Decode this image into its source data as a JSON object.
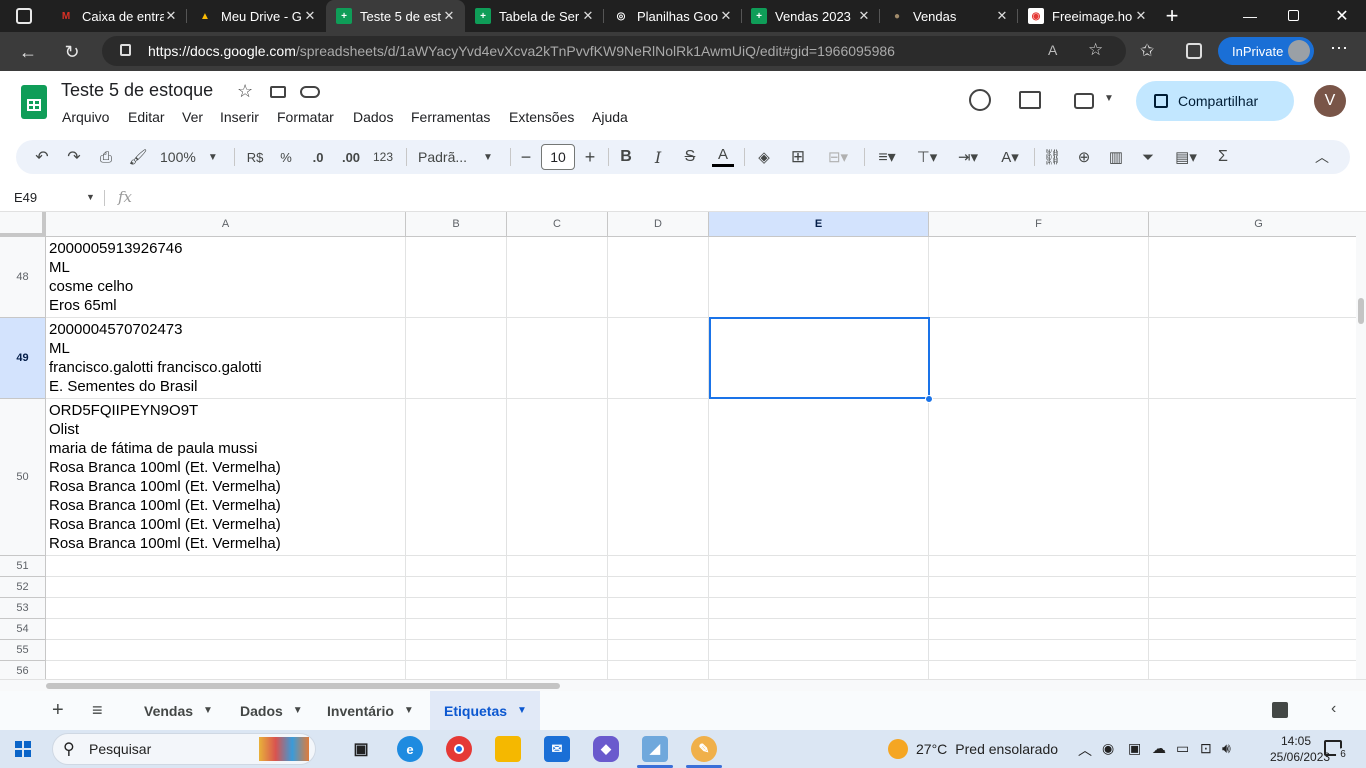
{
  "browser": {
    "tabs": [
      {
        "title": "Caixa de entra",
        "icon": "M",
        "icon_color": "#d93025",
        "icon_bg": "#202020"
      },
      {
        "title": "Meu Drive - G",
        "icon": "▲",
        "icon_color": "#fbbc04",
        "icon_bg": "#202020"
      },
      {
        "title": "Teste 5 de est",
        "icon": "+",
        "icon_color": "#ffffff",
        "icon_bg": "#0f9d58",
        "active": true
      },
      {
        "title": "Tabela de Ser",
        "icon": "+",
        "icon_color": "#ffffff",
        "icon_bg": "#0f9d58"
      },
      {
        "title": "Planilhas Goo",
        "icon": "◎",
        "icon_color": "#ffffff",
        "icon_bg": "#202020"
      },
      {
        "title": "Vendas 2023",
        "icon": "+",
        "icon_color": "#ffffff",
        "icon_bg": "#0f9d58"
      },
      {
        "title": "Vendas",
        "icon": "●",
        "icon_color": "#a08a6a",
        "icon_bg": "#202020"
      },
      {
        "title": "Freeimage.ho",
        "icon": "◉",
        "icon_color": "#e53935",
        "icon_bg": "#ffffff"
      }
    ],
    "url_domain": "https://docs.google.com",
    "url_path": "/spreadsheets/d/1aWYacyYvd4evXcva2kTnPvvfKW9NeRlNolRk1AwmUiQ/edit#gid=1966095986",
    "inprivate_label": "InPrivate"
  },
  "doc": {
    "title": "Teste 5 de estoque",
    "menus": [
      "Arquivo",
      "Editar",
      "Ver",
      "Inserir",
      "Formatar",
      "Dados",
      "Ferramentas",
      "Extensões",
      "Ajuda"
    ],
    "share_label": "Compartilhar",
    "avatar_letter": "V"
  },
  "toolbar": {
    "zoom": "100%",
    "currency": "R$",
    "percent": "%",
    "dec_decrease": ".0",
    "dec_increase": ".00",
    "number_format": "123",
    "font": "Padrã...",
    "font_size": "10",
    "bold": "B",
    "italic": "I",
    "strike": "S",
    "text_color": "A",
    "sum": "Σ"
  },
  "formula_bar": {
    "cell_ref": "E49",
    "fx": "fx"
  },
  "grid": {
    "columns": [
      "A",
      "B",
      "C",
      "D",
      "E",
      "F",
      "G"
    ],
    "selected_column": "E",
    "selected_row": "49",
    "rows": [
      {
        "num": "48",
        "lines": [
          "2000005913926746",
          "ML",
          "cosme celho",
          "Eros 65ml"
        ]
      },
      {
        "num": "49",
        "lines": [
          "2000004570702473",
          "ML",
          "francisco.galotti francisco.galotti",
          "E. Sementes do Brasil"
        ]
      },
      {
        "num": "50",
        "lines": [
          "ORD5FQIIPEYN9O9T",
          "Olist",
          "maria de fátima de paula mussi",
          "Rosa Branca 100ml (Et. Vermelha)",
          "Rosa Branca 100ml (Et. Vermelha)",
          "Rosa Branca 100ml (Et. Vermelha)",
          "Rosa Branca 100ml (Et. Vermelha)",
          "Rosa Branca 100ml (Et. Vermelha)"
        ]
      },
      {
        "num": "51",
        "lines": []
      },
      {
        "num": "52",
        "lines": []
      },
      {
        "num": "53",
        "lines": []
      },
      {
        "num": "54",
        "lines": []
      },
      {
        "num": "55",
        "lines": []
      },
      {
        "num": "56",
        "lines": []
      }
    ]
  },
  "sheets": {
    "tabs": [
      {
        "label": "Vendas"
      },
      {
        "label": "Dados"
      },
      {
        "label": "Inventário"
      },
      {
        "label": "Etiquetas",
        "active": true
      }
    ]
  },
  "taskbar": {
    "search_placeholder": "Pesquisar",
    "temperature": "27°C",
    "weather_text": "Pred ensolarado",
    "time": "14:05",
    "date": "25/06/2023",
    "notifications": "6"
  }
}
